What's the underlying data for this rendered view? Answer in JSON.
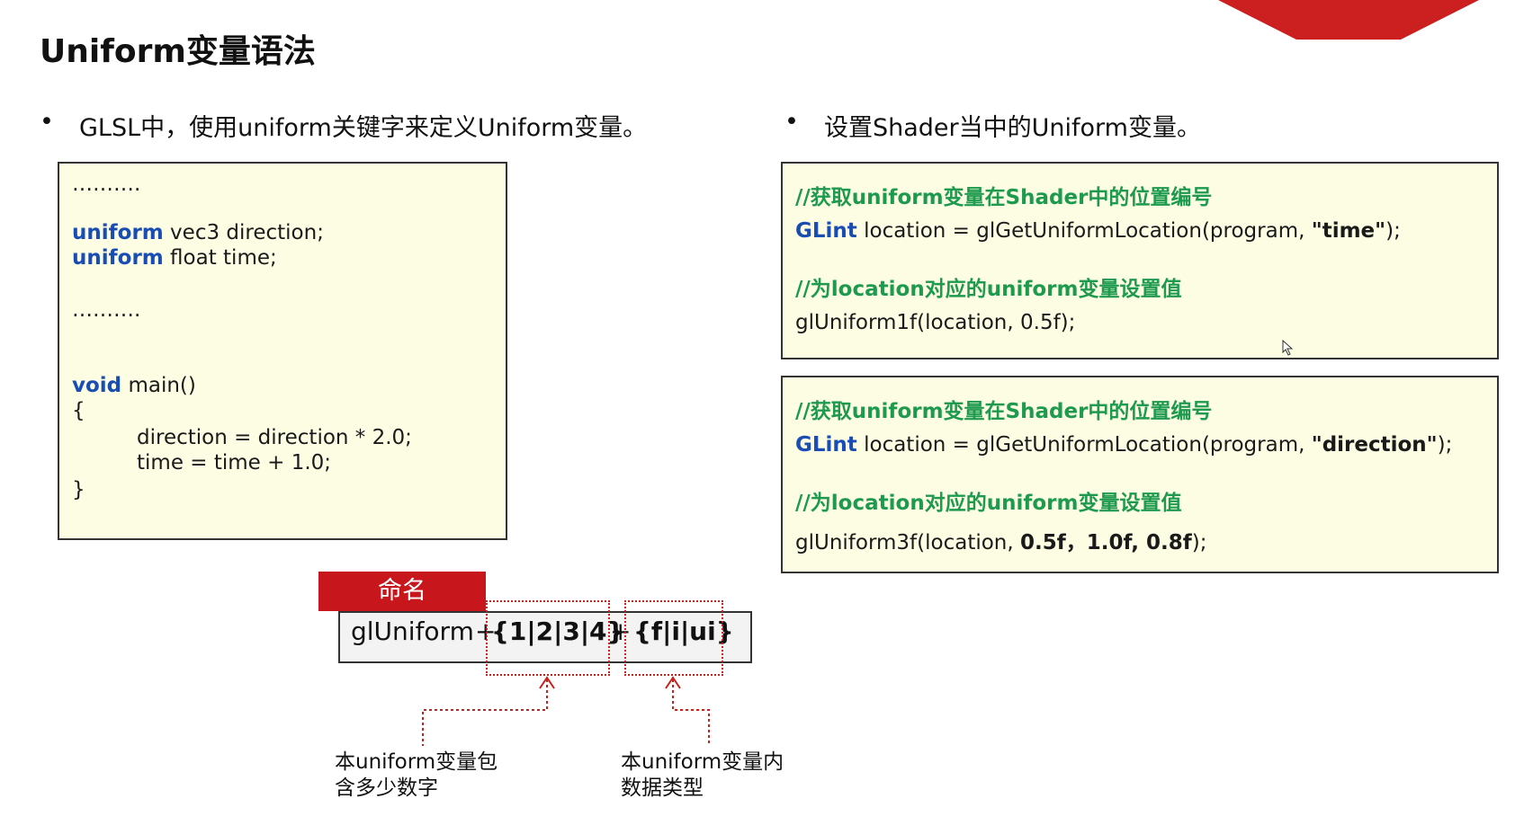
{
  "page": {
    "title": "Uniform变量语法",
    "left_bullet": "GLSL中，使用uniform关键字来定义Uniform变量。",
    "right_bullet": "设置Shader当中的Uniform变量。",
    "bullet_char": "•"
  },
  "glsl_code": {
    "ellipsis1": "……….",
    "line1_kw": "uniform",
    "line1_rest": " vec3 direction;",
    "line2_kw": "uniform",
    "line2_rest": " float time;",
    "ellipsis2": "……….",
    "main_kw": "void",
    "main_rest": " main()",
    "open_brace": "{",
    "body1": "direction = direction * 2.0;",
    "body2": "time = time  + 1.0;",
    "close_brace": "}"
  },
  "panel1": {
    "comment1": "//获取uniform变量在Shader中的位置编号",
    "type_kw": "GLint",
    "call_pre": " location = glGetUniformLocation(program, ",
    "arg": "\"time\"",
    "call_post": ");",
    "comment2": "//为location对应的uniform变量设置值",
    "set_call": "glUniform1f(location, 0.5f);"
  },
  "panel2": {
    "comment1": "//获取uniform变量在Shader中的位置编号",
    "type_kw": "GLint",
    "call_pre": " location = glGetUniformLocation(program, ",
    "arg": "\"direction\"",
    "call_post": ");",
    "comment2": "//为location对应的uniform变量设置值",
    "set_pre": "glUniform3f(location, ",
    "set_vals": "0.5f，1.0f, 0.8f",
    "set_post": ");"
  },
  "diagram": {
    "tag": "命名",
    "fn": "glUniform",
    "plus1": "+",
    "count_part": "{1|2|3|4}",
    "plus2": "+",
    "type_part": "{f|i|ui}",
    "note1_line1": "本uniform变量包",
    "note1_line2": "含多少数字",
    "note2_line1": "本uniform变量内",
    "note2_line2": "数据类型"
  },
  "colors": {
    "keyword": "#1a4db3",
    "comment": "#1e9a4f",
    "accent_red": "#c8161d",
    "code_bg": "#fdfde4"
  },
  "icons": [
    "mouse-cursor-icon"
  ]
}
